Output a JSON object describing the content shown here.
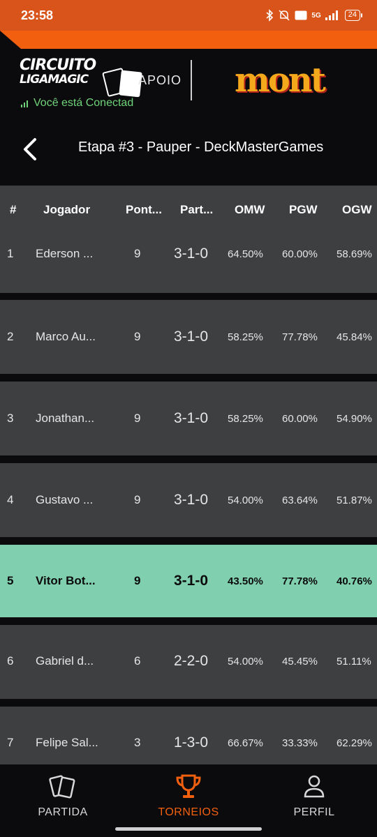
{
  "status_bar": {
    "time": "23:58",
    "battery": "24",
    "network": "5G"
  },
  "header": {
    "logo_line1": "CIRCUITO",
    "logo_line2": "LIGAMAGIC",
    "connection_status": "Você está Conectad",
    "sponsor_label": "APOIO",
    "sponsor_name": "mont",
    "title": "Etapa #3 - Pauper - DeckMasterGames"
  },
  "table": {
    "columns": [
      "#",
      "Jogador",
      "Pont...",
      "Part...",
      "OMW",
      "PGW",
      "OGW"
    ],
    "rows": [
      {
        "rank": "1",
        "player": "Ederson ...",
        "points": "9",
        "record": "3-1-0",
        "omw": "64.50%",
        "pgw": "60.00%",
        "ogw": "58.69%"
      },
      {
        "rank": "2",
        "player": "Marco Au...",
        "points": "9",
        "record": "3-1-0",
        "omw": "58.25%",
        "pgw": "77.78%",
        "ogw": "45.84%"
      },
      {
        "rank": "3",
        "player": "Jonathan...",
        "points": "9",
        "record": "3-1-0",
        "omw": "58.25%",
        "pgw": "60.00%",
        "ogw": "54.90%"
      },
      {
        "rank": "4",
        "player": "Gustavo ...",
        "points": "9",
        "record": "3-1-0",
        "omw": "54.00%",
        "pgw": "63.64%",
        "ogw": "51.87%"
      },
      {
        "rank": "5",
        "player": "Vitor Bot...",
        "points": "9",
        "record": "3-1-0",
        "omw": "43.50%",
        "pgw": "77.78%",
        "ogw": "40.76%"
      },
      {
        "rank": "6",
        "player": "Gabriel d...",
        "points": "6",
        "record": "2-2-0",
        "omw": "54.00%",
        "pgw": "45.45%",
        "ogw": "51.11%"
      },
      {
        "rank": "7",
        "player": "Felipe Sal...",
        "points": "3",
        "record": "1-3-0",
        "omw": "66.67%",
        "pgw": "33.33%",
        "ogw": "62.29%"
      }
    ]
  },
  "nav": {
    "partida": "PARTIDA",
    "torneios": "TORNEIOS",
    "perfil": "PERFIL"
  },
  "colors": {
    "accent": "#f2600f",
    "highlight_row": "#80cfae",
    "row_bg": "#3d3f41",
    "connected": "#6fd37a"
  }
}
